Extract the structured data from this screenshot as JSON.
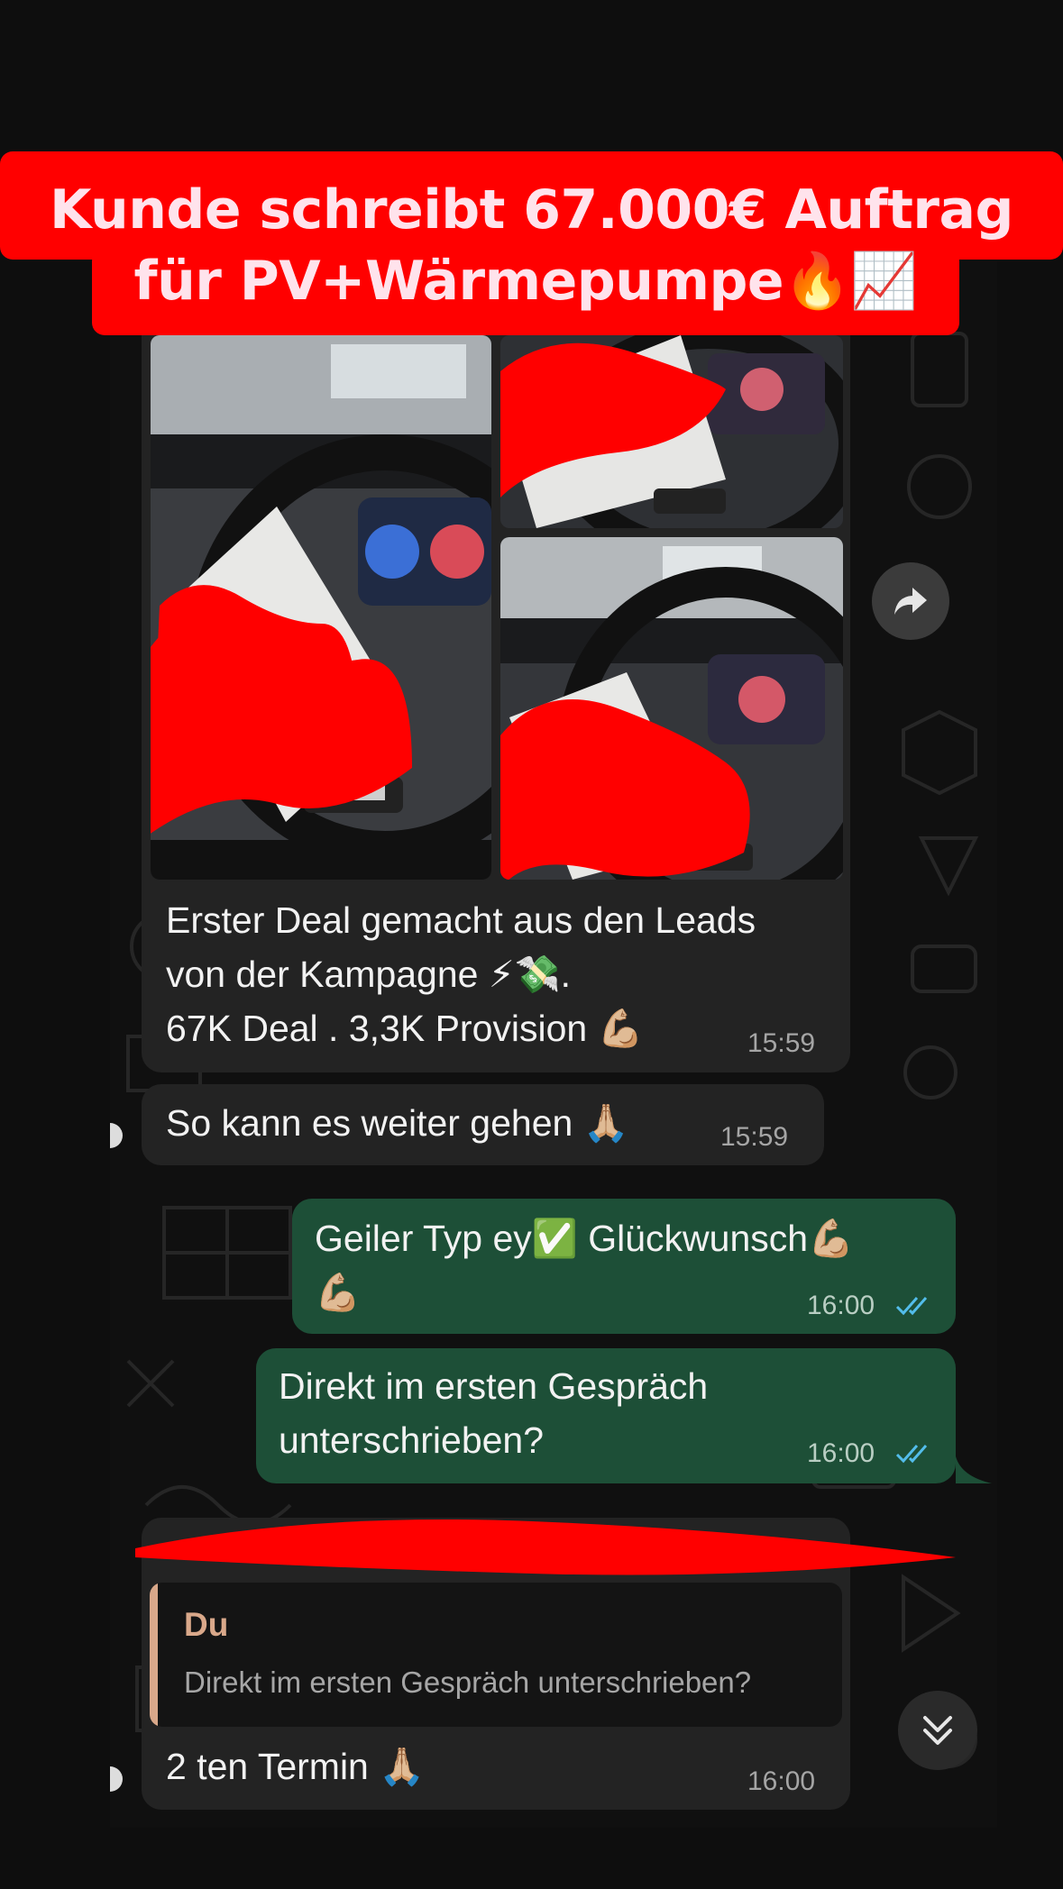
{
  "banner": {
    "line1": "Kunde schreibt 67.000€ Auftrag",
    "line2": "für PV+Wärmepumpe🔥📈"
  },
  "colors": {
    "banner": "#ff0000",
    "incoming_bubble": "#232323",
    "outgoing_bubble": "#1d4f37",
    "read_ticks": "#53bdeb",
    "quote_accent": "#d9a88a"
  },
  "messages": [
    {
      "id": "msg-photos",
      "direction": "incoming",
      "photos": [
        "car-dashboard-photo",
        "car-dashboard-photo",
        "car-dashboard-photo"
      ],
      "lines": [
        "Erster Deal gemacht aus den Leads",
        "von der Kampagne ⚡💸.",
        "67K Deal . 3,3K Provision 💪🏼"
      ],
      "time": "15:59"
    },
    {
      "id": "msg-weiter",
      "direction": "incoming",
      "lines": [
        "So kann es weiter gehen 🙏🏼"
      ],
      "time": "15:59"
    },
    {
      "id": "msg-geiler",
      "direction": "outgoing",
      "lines": [
        "Geiler Typ ey✅ Glückwunsch💪🏼",
        "💪🏼"
      ],
      "time": "16:00",
      "status": "read"
    },
    {
      "id": "msg-direkt",
      "direction": "outgoing",
      "lines": [
        "Direkt im ersten Gespräch",
        "unterschrieben?"
      ],
      "time": "16:00",
      "status": "read"
    },
    {
      "id": "msg-reply",
      "direction": "incoming",
      "sender_visible": "...",
      "quote": {
        "author": "Du",
        "text": "Direkt im ersten Gespräch unterschrieben?"
      },
      "lines": [
        "2 ten Termin 🙏🏼"
      ],
      "time": "16:00"
    }
  ],
  "icons": {
    "forward": "forward-arrow-icon",
    "scroll": "double-chevron-down-icon",
    "ticks": "double-check-icon"
  }
}
